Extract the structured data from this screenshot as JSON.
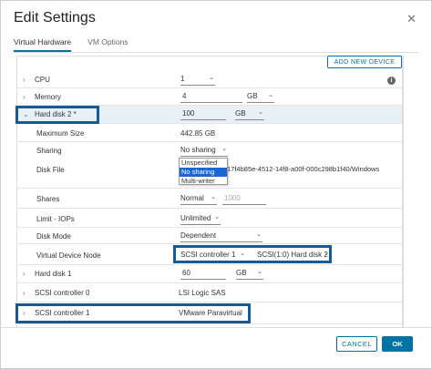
{
  "dialog": {
    "title": "Edit Settings",
    "close_glyph": "✕",
    "tabs": [
      "Virtual Hardware",
      "VM Options"
    ],
    "add_device_label": "ADD NEW DEVICE",
    "info_glyph": "i"
  },
  "hardware": {
    "cpu": {
      "label": "CPU",
      "value": "1"
    },
    "memory": {
      "label": "Memory",
      "value": "4",
      "unit": "GB"
    },
    "hard_disk_2": {
      "label": "Hard disk 2 *",
      "value": "100",
      "unit": "GB",
      "max_size_label": "Maximum Size",
      "max_size_value": "442.85 GB",
      "sharing_label": "Sharing",
      "sharing_value": "No sharing",
      "sharing_options": [
        "Unspecified",
        "No sharing",
        "Multi-writer"
      ],
      "disk_file_label": "Disk File",
      "disk_file_value": "17f4b85e-4512-14f8-a00f-000c298b1f40/Windows",
      "shares_label": "Shares",
      "shares_value": "Normal",
      "shares_number": "1000",
      "limit_label": "Limit - IOPs",
      "limit_value": "Unlimited",
      "disk_mode_label": "Disk Mode",
      "disk_mode_value": "Dependent",
      "vdn_label": "Virtual Device Node",
      "vdn_controller": "SCSI controller 1",
      "vdn_slot": "SCSI(1:0) Hard disk 2"
    },
    "hard_disk_1": {
      "label": "Hard disk 1",
      "value": "60",
      "unit": "GB"
    },
    "scsi_0": {
      "label": "SCSI controller 0",
      "value": "LSI Logic SAS"
    },
    "scsi_1": {
      "label": "SCSI controller 1",
      "value": "VMware Paravirtual"
    }
  },
  "footer": {
    "cancel_label": "CANCEL",
    "ok_label": "OK"
  },
  "colors": {
    "accent": "#0072a3",
    "callout": "#155b98",
    "highlight_row": "#e6f0f5",
    "selected_option": "#1a66d2"
  }
}
